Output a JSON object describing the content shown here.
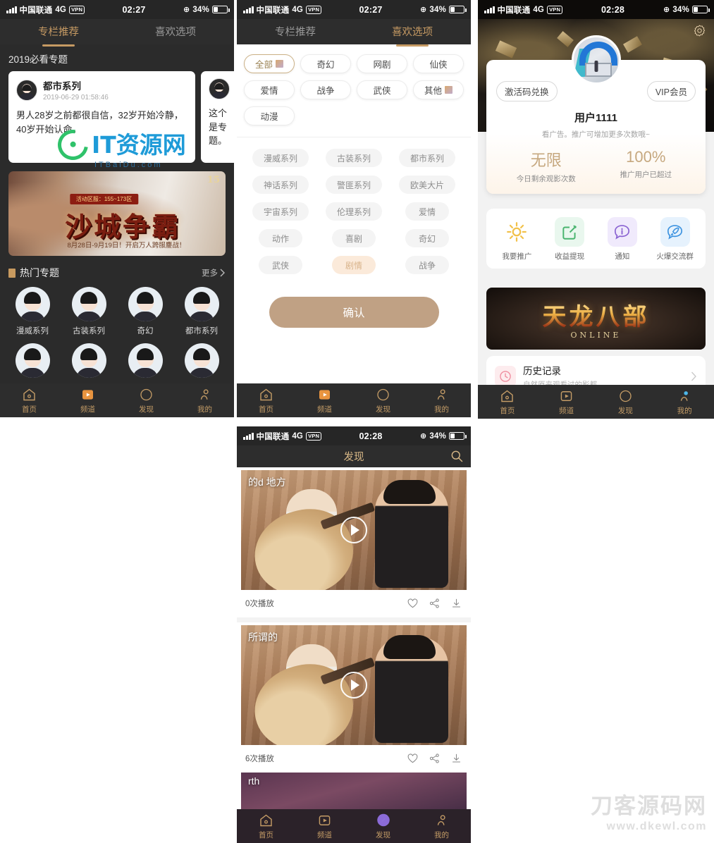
{
  "status_bar": {
    "carrier": "中国联通",
    "network": "4G",
    "vpn": "VPN",
    "time_0227": "02:27",
    "time_0228": "02:28",
    "battery": "34%"
  },
  "panel1": {
    "tabs": [
      {
        "label": "专栏推荐",
        "active": true
      },
      {
        "label": "喜欢选项",
        "active": false
      }
    ],
    "section_title": "2019必看专题",
    "cards": [
      {
        "title": "都市系列",
        "date": "2019-06-29 01:58:46",
        "body": "男人28岁之前都很自信，32岁开始冷静，40岁开始认命。"
      },
      {
        "title": "",
        "date": "",
        "body": "这个是专题。"
      }
    ],
    "banner": {
      "strip": "活动区服：155~173区",
      "main": "沙城争霸",
      "sub": "8月28日-9月19日！开启万人跨服鏖战！",
      "logo": "15"
    },
    "hot": {
      "title": "热门专题",
      "more": "更多"
    },
    "grid": [
      {
        "label": "漫威系列"
      },
      {
        "label": "古装系列"
      },
      {
        "label": "奇幻"
      },
      {
        "label": "都市系列"
      },
      {
        "label": ""
      },
      {
        "label": ""
      },
      {
        "label": ""
      },
      {
        "label": ""
      }
    ],
    "nav": [
      {
        "label": "首页",
        "icon": "home-icon"
      },
      {
        "label": "频道",
        "icon": "channel-icon"
      },
      {
        "label": "发现",
        "icon": "discover-icon"
      },
      {
        "label": "我的",
        "icon": "profile-icon"
      }
    ]
  },
  "panel2": {
    "tabs": [
      {
        "label": "专栏推荐",
        "active": false
      },
      {
        "label": "喜欢选项",
        "active": true
      }
    ],
    "top_chips": [
      {
        "label": "全部",
        "selected": true,
        "swatch": true
      },
      {
        "label": "奇幻",
        "selected": false,
        "swatch": false
      },
      {
        "label": "网剧",
        "selected": false,
        "swatch": false
      },
      {
        "label": "仙侠",
        "selected": false,
        "swatch": false
      },
      {
        "label": "爱情",
        "selected": false,
        "swatch": false
      },
      {
        "label": "战争",
        "selected": false,
        "swatch": false
      },
      {
        "label": "武侠",
        "selected": false,
        "swatch": false
      },
      {
        "label": "其他",
        "selected": false,
        "swatch": true
      },
      {
        "label": "动漫",
        "selected": false,
        "swatch": false
      }
    ],
    "grid_chips": [
      {
        "label": "漫威系列",
        "selected": false
      },
      {
        "label": "古装系列",
        "selected": false
      },
      {
        "label": "都市系列",
        "selected": false
      },
      {
        "label": "神话系列",
        "selected": false
      },
      {
        "label": "警匪系列",
        "selected": false
      },
      {
        "label": "欧美大片",
        "selected": false
      },
      {
        "label": "宇宙系列",
        "selected": false
      },
      {
        "label": "伦理系列",
        "selected": false
      },
      {
        "label": "爱情",
        "selected": false
      },
      {
        "label": "动作",
        "selected": false
      },
      {
        "label": "喜剧",
        "selected": false
      },
      {
        "label": "奇幻",
        "selected": false
      },
      {
        "label": "武侠",
        "selected": false
      },
      {
        "label": "剧情",
        "selected": true
      },
      {
        "label": "战争",
        "selected": false
      }
    ],
    "confirm_label": "确认",
    "nav": [
      {
        "label": "首页"
      },
      {
        "label": "频道"
      },
      {
        "label": "发现"
      },
      {
        "label": "我的"
      }
    ]
  },
  "panel3": {
    "gear_icon": "gear-icon",
    "redeem_label": "激活码兑换",
    "vip_label": "VIP会员",
    "username": "用户1111",
    "desc": "看广告。推广可增加更多次数哦~",
    "stats": [
      {
        "value": "无限",
        "caption": "今日剩余观影次数"
      },
      {
        "value": "100%",
        "caption": "推广用户已超过"
      }
    ],
    "quick_icons": [
      {
        "label": "我要推广",
        "icon": "sun-icon",
        "bg": "#ffffff",
        "color": "#f2c14a"
      },
      {
        "label": "收益提现",
        "icon": "edit-icon",
        "bg": "#e9f7ee",
        "color": "#48b46e"
      },
      {
        "label": "通知",
        "icon": "info-icon",
        "bg": "#f0eafc",
        "color": "#8a63d2"
      },
      {
        "label": "火爆交流群",
        "icon": "rocket-icon",
        "bg": "#e6f2fd",
        "color": "#3d93e0"
      }
    ],
    "game_banner": {
      "main": "天龙八部",
      "sub": "ONLINE"
    },
    "history": {
      "title": "历史记录",
      "subtitle": "自然原来观看过的影都"
    },
    "nav": [
      {
        "label": "首页"
      },
      {
        "label": "频道"
      },
      {
        "label": "发现"
      },
      {
        "label": "我的",
        "active": true
      }
    ]
  },
  "panel4": {
    "header_title": "发现",
    "search_icon": "search-icon",
    "videos": [
      {
        "title": "的d 地方",
        "plays": "0次播放"
      },
      {
        "title": "所谓的",
        "plays": "6次播放"
      },
      {
        "title": "rth",
        "plays": ""
      }
    ],
    "action_icons": [
      "heart-icon",
      "share-icon",
      "download-icon"
    ],
    "nav": [
      {
        "label": "首页"
      },
      {
        "label": "频道"
      },
      {
        "label": "发现",
        "active": true
      },
      {
        "label": "我的"
      }
    ]
  },
  "watermarks": {
    "it": {
      "name": "IT资源网",
      "url": "ITBaiDu.com"
    },
    "dk": {
      "name": "刀客源码网",
      "url": "www.dkewl.com"
    }
  },
  "colors": {
    "accent": "#c69a63",
    "confirm": "#c0a184",
    "dark": "#2d2d2d"
  }
}
